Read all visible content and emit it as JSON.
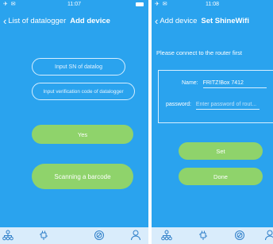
{
  "left": {
    "status": {
      "signal": "✈ ✉",
      "time": "11:07"
    },
    "nav": {
      "back_label": "List of datalogger",
      "title": "Add device"
    },
    "sn_input": {
      "placeholder": "Input SN of datalog"
    },
    "code_input": {
      "placeholder": "Input verification code of datalogger"
    },
    "yes_button": "Yes",
    "scan_button": "Scanning a barcode"
  },
  "right": {
    "status": {
      "signal": "✈ ✉",
      "time": "11:08"
    },
    "nav": {
      "back_label": "Add device",
      "title": "Set ShineWifi"
    },
    "hint": "Please connect to the router first",
    "name_label": "Name:",
    "name_value": "FRITZ!Box 7412",
    "password_label": "password:",
    "password_placeholder": "Enter password of rout...",
    "set_button": "Set",
    "done_button": "Done"
  },
  "tabbar": {
    "icons": [
      "network-icon",
      "plug-icon",
      "gauge-icon",
      "person-icon"
    ],
    "color": "#2f7fc9"
  }
}
